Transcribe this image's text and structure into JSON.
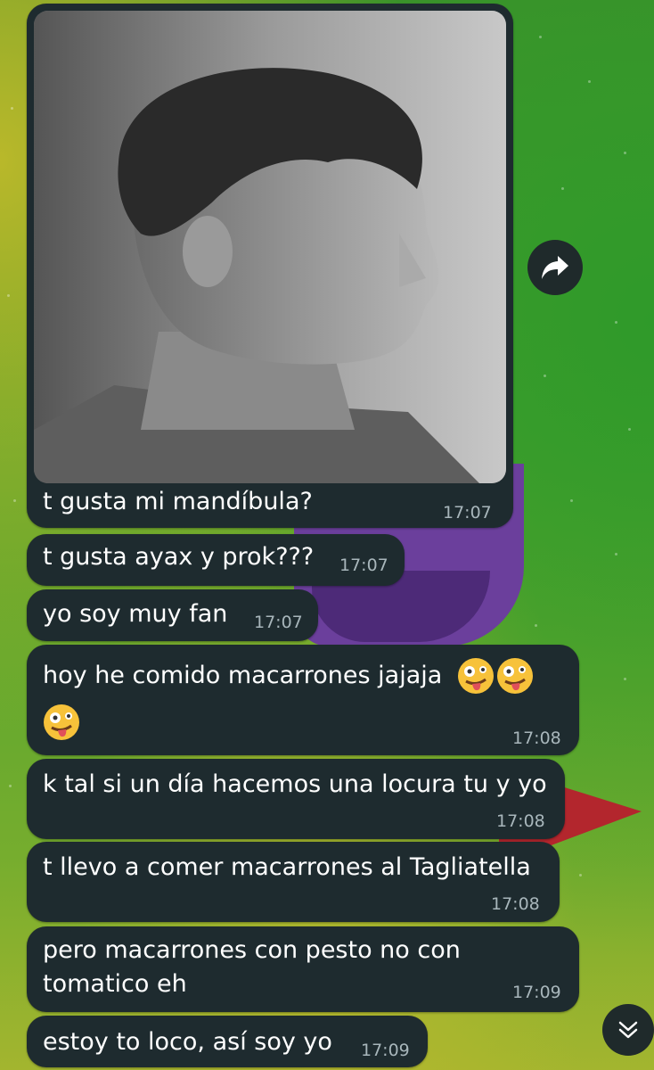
{
  "messages": [
    {
      "text": "t gusta mi mandíbula?",
      "time": "17:07"
    },
    {
      "text": "t gusta ayax y prok???",
      "time": "17:07"
    },
    {
      "text": "yo soy muy fan",
      "time": "17:07"
    },
    {
      "text": "hoy he comido macarrones jajaja",
      "time": "17:08",
      "emoji_count": 3
    },
    {
      "text": "k tal si un día hacemos una locura tu y yo",
      "time": "17:08"
    },
    {
      "text": "t llevo a comer macarrones al Tagliatella",
      "time": "17:08"
    },
    {
      "text_line1": "pero macarrones con pesto no con",
      "text_line2": "tomatico eh",
      "time": "17:09"
    },
    {
      "text": "estoy to loco, así soy yo",
      "time": "17:09"
    }
  ],
  "icons": {
    "forward": "share-arrow-icon",
    "scroll": "chevron-double-down-icon",
    "emoji": "zany-face-emoji"
  },
  "colors": {
    "bubble": "#1e2b2f",
    "time": "#a8b6bb",
    "wallpaper_green": "#4aa12d",
    "wallpaper_purple": "#6b3f9c",
    "wallpaper_red": "#b3262d"
  }
}
